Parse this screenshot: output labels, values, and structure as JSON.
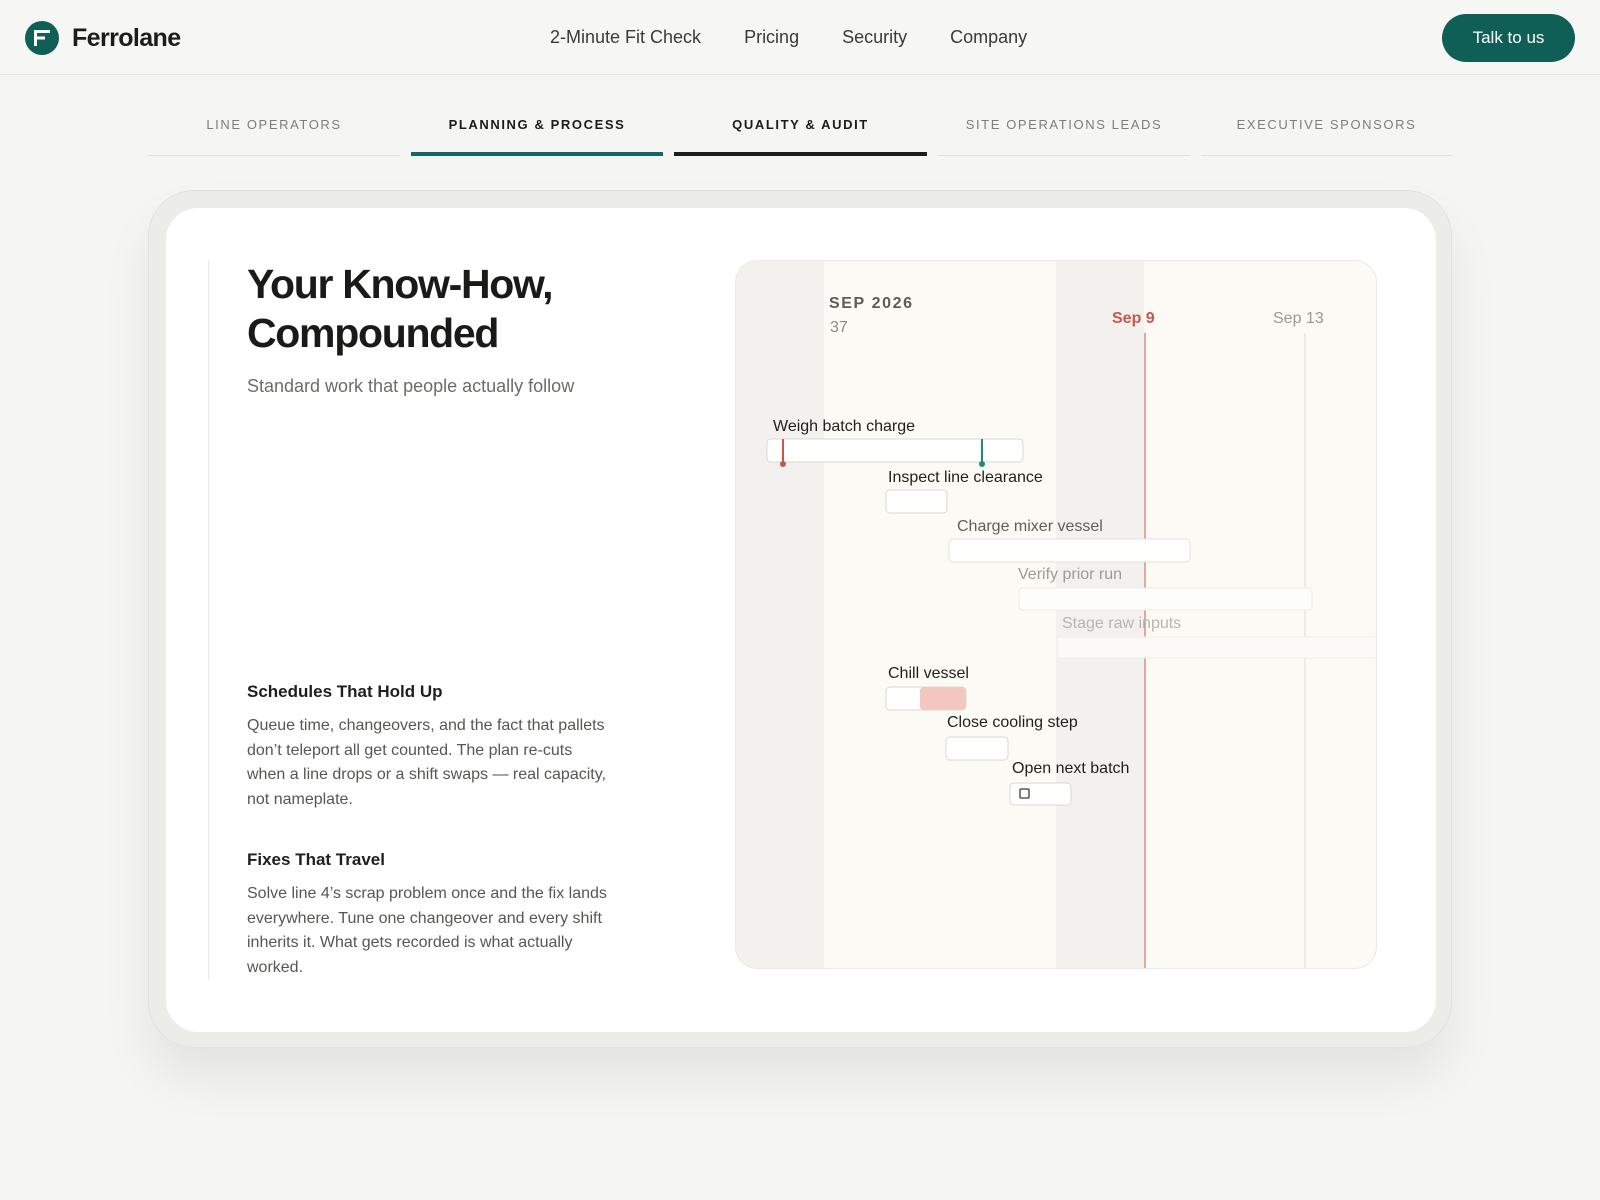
{
  "header": {
    "brand": "Ferrolane",
    "nav": [
      "2-Minute Fit Check",
      "Pricing",
      "Security",
      "Company"
    ],
    "cta_label": "Talk to us"
  },
  "tabs": [
    {
      "label": "Line Operators",
      "state": "inactive"
    },
    {
      "label": "Planning & Process",
      "state": "active-teal"
    },
    {
      "label": "Quality & Audit",
      "state": "active-dark"
    },
    {
      "label": "Site Operations Leads",
      "state": "inactive"
    },
    {
      "label": "Executive Sponsors",
      "state": "inactive"
    }
  ],
  "content": {
    "title": "Your Know-How, Compounded",
    "subtitle": "Standard work that people actually follow",
    "sections": [
      {
        "title": "Schedules That Hold Up",
        "body": "Queue time, changeovers, and the fact that pallets don’t teleport all get counted. The plan re-cuts when a line drops or a shift swaps — real capacity, not nameplate."
      },
      {
        "title": "Fixes That Travel",
        "body": "Solve line 4’s scrap problem once and the fix lands everywhere. Tune one changeover and every shift inherits it. What gets recorded is what actually worked."
      }
    ]
  },
  "gantt": {
    "month": "SEP 2026",
    "week": "37",
    "today_label": "Sep 9",
    "end_label": "Sep 13",
    "tasks": [
      {
        "label": "Weigh batch charge",
        "tone": "strong"
      },
      {
        "label": "Inspect line clearance",
        "tone": "strong"
      },
      {
        "label": "Charge mixer vessel",
        "tone": "mid"
      },
      {
        "label": "Verify prior run",
        "tone": "faint"
      },
      {
        "label": "Stage raw inputs",
        "tone": "fainter"
      },
      {
        "label": "Chill vessel",
        "tone": "strong"
      },
      {
        "label": "Close cooling step",
        "tone": "strong"
      },
      {
        "label": "Open next batch",
        "tone": "strong"
      }
    ],
    "colors": {
      "accent": "#0f5f57",
      "today": "#c8574d",
      "cooling_fill": "#f4c6c0"
    }
  }
}
